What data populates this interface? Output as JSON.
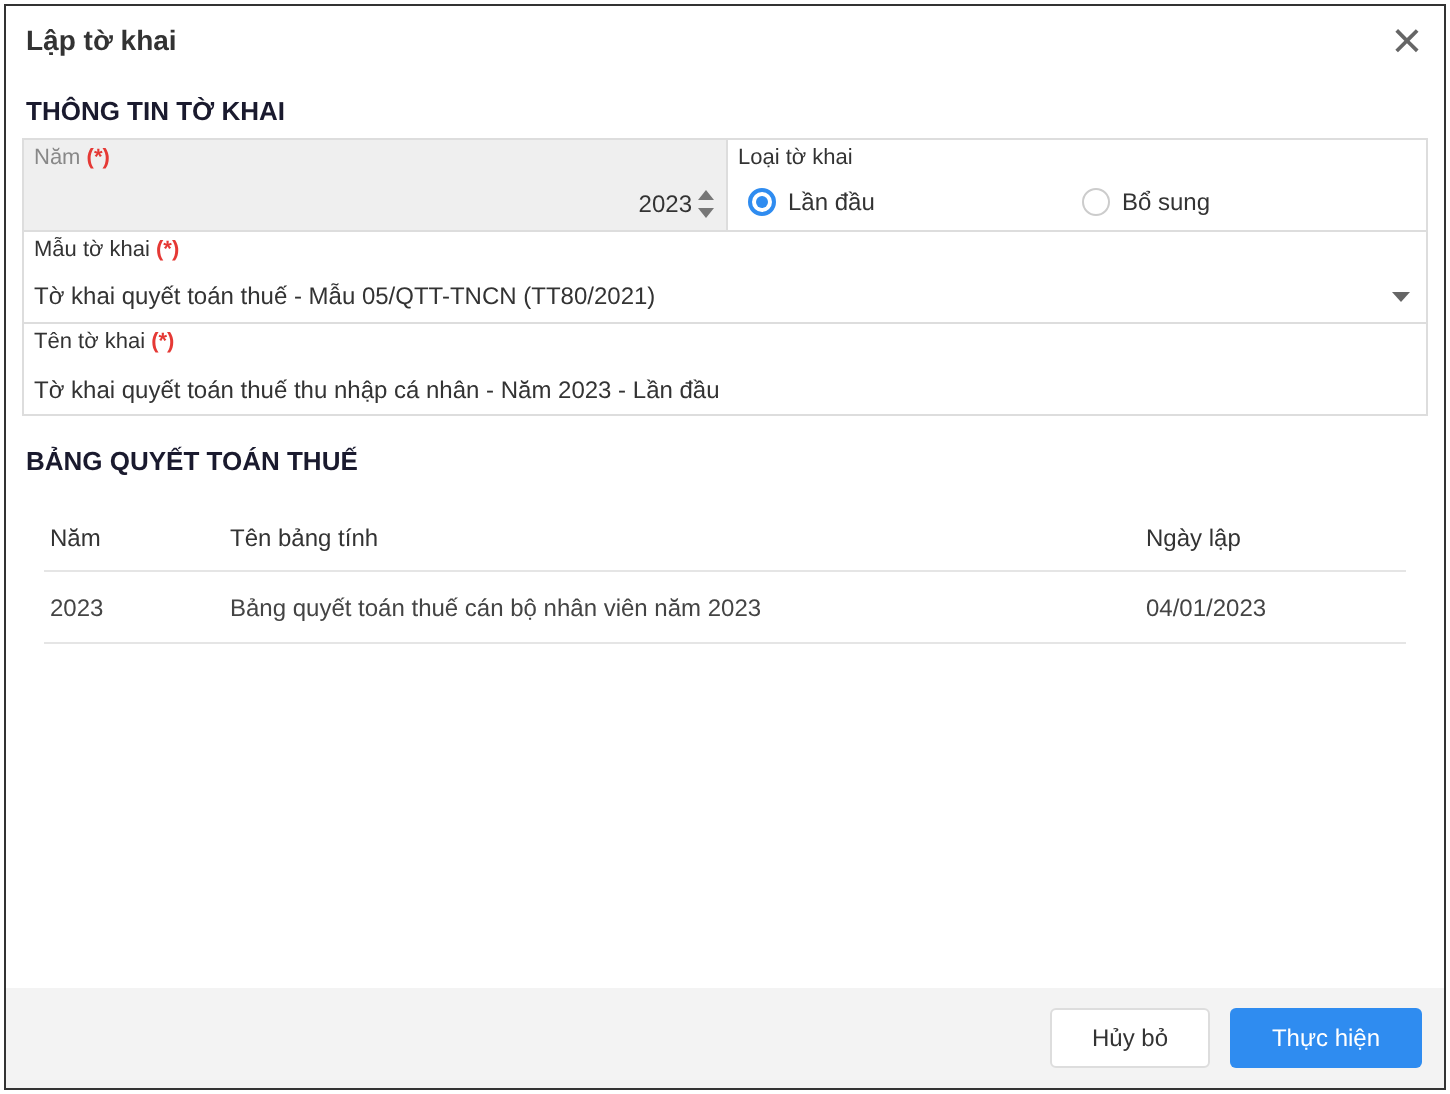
{
  "window": {
    "title": "Lập tờ khai",
    "close": "×"
  },
  "info_section": {
    "title": "THÔNG TIN TỜ KHAI",
    "year": {
      "label": "Năm",
      "required": "(*)",
      "value": "2023",
      "disabled": true
    },
    "declaration_type": {
      "label": "Loại tờ khai",
      "options": [
        {
          "label": "Lần đầu",
          "selected": true
        },
        {
          "label": "Bổ sung",
          "selected": false
        }
      ]
    },
    "template": {
      "label": "Mẫu tờ khai",
      "required": "(*)",
      "value": "Tờ khai quyết toán thuế - Mẫu 05/QTT-TNCN (TT80/2021)"
    },
    "name": {
      "label": "Tên tờ khai",
      "required": "(*)",
      "value": "Tờ khai quyết toán thuế thu nhập cá nhân - Năm 2023 - Lần đầu"
    }
  },
  "settlement_section": {
    "title": "BẢNG QUYẾT TOÁN THUẾ",
    "table": {
      "columns": [
        "Năm",
        "Tên bảng tính",
        "Ngày lập"
      ],
      "rows": [
        [
          "2023",
          "Bảng quyết toán thuế cán bộ nhân viên năm 2023",
          "04/01/2023"
        ]
      ]
    }
  },
  "buttons": [
    {
      "label": "Hủy bỏ",
      "kind": "secondary"
    },
    {
      "label": "Thực hiện",
      "kind": "primary"
    }
  ]
}
